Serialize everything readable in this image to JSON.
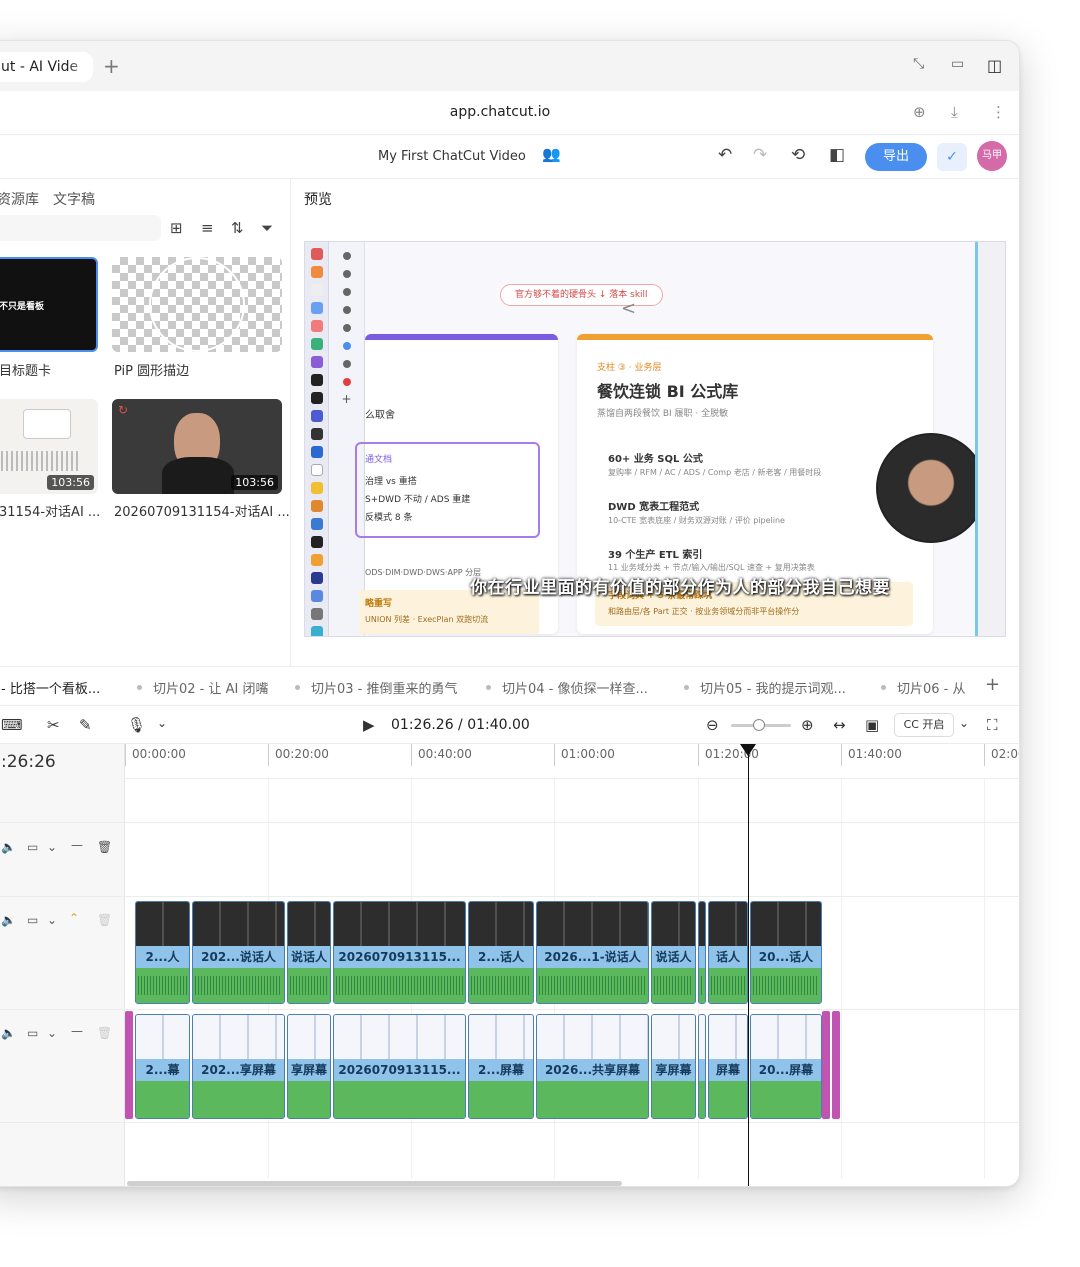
{
  "browser": {
    "tab_title": "ut - AI Vide",
    "new_tab": "+",
    "url": "app.chatcut.io"
  },
  "header": {
    "project_title": "My First ChatCut Video",
    "export_label": "导出",
    "avatar_text": "马甲"
  },
  "left_panel": {
    "tabs": [
      "资源库",
      "文字稿"
    ],
    "assets": [
      {
        "label": "目标题卡",
        "thumb_text": "不只是看板"
      },
      {
        "label": "PiP 圆形描边"
      },
      {
        "label": "31154-对话AI ...",
        "duration": "103:56"
      },
      {
        "label": "20260709131154-对话AI ...",
        "duration": "103:56"
      }
    ]
  },
  "preview": {
    "title": "预览",
    "pill_text": "官方够不着的硬骨头 ↓ 落本 skill",
    "left_card": {
      "line1": "么取舍",
      "box_title": "通文档",
      "box_lines": [
        "治理 vs 重搭",
        "S+DWD 不动 / ADS 重建",
        "反模式 8 条"
      ],
      "layers": "ODS·DIM·DWD·DWS·APP 分层",
      "bottom_title": "略重写",
      "bottom_sub": "UNION 列差 · ExecPlan 双跑切流"
    },
    "right_card": {
      "tag": "支柱 ③ · 业务层",
      "title": "餐饮连锁 BI 公式库",
      "subtitle": "蒸馏自两段餐饮 BI 履职 · 全脱敏",
      "items": [
        {
          "title": "60+ 业务 SQL 公式",
          "sub": "复购率 / RFM / AC / ADS / Comp 老店 / 新老客 / 用餐时段"
        },
        {
          "title": "DWD 宽表工程范式",
          "sub": "10-CTE 宽表底座 / 财务双源对账 / 评价 pipeline"
        },
        {
          "title": "39 个生产 ETL 索引",
          "sub": "11 业务域分类 + 节点/输入/输出/SQL 速查 + 复用决策表"
        },
        {
          "title": "字段词典 + 5 条最常踩坑",
          "sub": "和路由层/各 Part 正交 · 按业务领域分而非平台操作分"
        }
      ]
    },
    "subtitle": "你在行业里面的有价值的部分作为人的部分我自己想要"
  },
  "clip_tabs": [
    "- 比搭一个看板...",
    "切片02 - 让 AI 闭嘴",
    "切片03 - 推倒重来的勇气",
    "切片04 - 像侦探一样查...",
    "切片05 - 我的提示词观...",
    "切片06 - 从"
  ],
  "toolbar": {
    "timecode": "01:26.26 / 01:40.00",
    "cc_label": "开启"
  },
  "timeline": {
    "current_time": ":26:26",
    "ruler": [
      "00:00:00",
      "00:20:00",
      "00:40:00",
      "01:00:00",
      "01:20:00",
      "01:40:00",
      "02:00"
    ],
    "video_clips": [
      "2...人",
      "202...说话人",
      "说话人",
      "2026070913115...",
      "2...话人",
      "2026...1-说话人",
      "说话人",
      "",
      "话人",
      "20...话人"
    ],
    "screen_clips": [
      "2...幕",
      "202...享屏幕",
      "享屏幕",
      "2026070913115...",
      "2...屏幕",
      "2026...共享屏幕",
      "享屏幕",
      "",
      "屏幕",
      "20...屏幕"
    ]
  }
}
